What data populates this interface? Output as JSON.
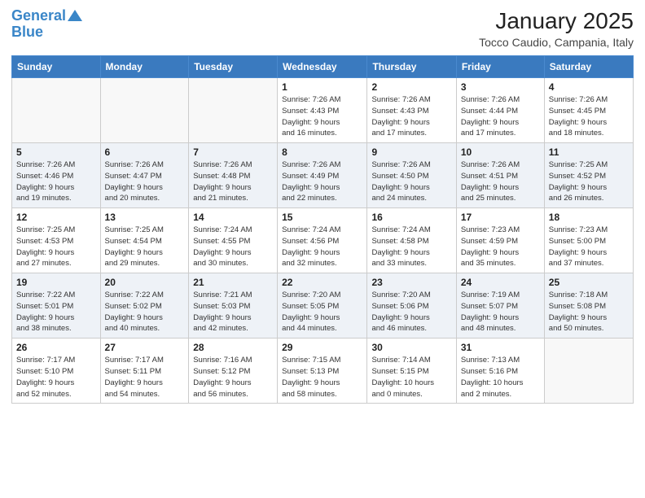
{
  "header": {
    "logo_line1": "General",
    "logo_line2": "Blue",
    "month": "January 2025",
    "location": "Tocco Caudio, Campania, Italy"
  },
  "weekdays": [
    "Sunday",
    "Monday",
    "Tuesday",
    "Wednesday",
    "Thursday",
    "Friday",
    "Saturday"
  ],
  "weeks": [
    [
      {
        "day": "",
        "info": ""
      },
      {
        "day": "",
        "info": ""
      },
      {
        "day": "",
        "info": ""
      },
      {
        "day": "1",
        "info": "Sunrise: 7:26 AM\nSunset: 4:43 PM\nDaylight: 9 hours\nand 16 minutes."
      },
      {
        "day": "2",
        "info": "Sunrise: 7:26 AM\nSunset: 4:43 PM\nDaylight: 9 hours\nand 17 minutes."
      },
      {
        "day": "3",
        "info": "Sunrise: 7:26 AM\nSunset: 4:44 PM\nDaylight: 9 hours\nand 17 minutes."
      },
      {
        "day": "4",
        "info": "Sunrise: 7:26 AM\nSunset: 4:45 PM\nDaylight: 9 hours\nand 18 minutes."
      }
    ],
    [
      {
        "day": "5",
        "info": "Sunrise: 7:26 AM\nSunset: 4:46 PM\nDaylight: 9 hours\nand 19 minutes."
      },
      {
        "day": "6",
        "info": "Sunrise: 7:26 AM\nSunset: 4:47 PM\nDaylight: 9 hours\nand 20 minutes."
      },
      {
        "day": "7",
        "info": "Sunrise: 7:26 AM\nSunset: 4:48 PM\nDaylight: 9 hours\nand 21 minutes."
      },
      {
        "day": "8",
        "info": "Sunrise: 7:26 AM\nSunset: 4:49 PM\nDaylight: 9 hours\nand 22 minutes."
      },
      {
        "day": "9",
        "info": "Sunrise: 7:26 AM\nSunset: 4:50 PM\nDaylight: 9 hours\nand 24 minutes."
      },
      {
        "day": "10",
        "info": "Sunrise: 7:26 AM\nSunset: 4:51 PM\nDaylight: 9 hours\nand 25 minutes."
      },
      {
        "day": "11",
        "info": "Sunrise: 7:25 AM\nSunset: 4:52 PM\nDaylight: 9 hours\nand 26 minutes."
      }
    ],
    [
      {
        "day": "12",
        "info": "Sunrise: 7:25 AM\nSunset: 4:53 PM\nDaylight: 9 hours\nand 27 minutes."
      },
      {
        "day": "13",
        "info": "Sunrise: 7:25 AM\nSunset: 4:54 PM\nDaylight: 9 hours\nand 29 minutes."
      },
      {
        "day": "14",
        "info": "Sunrise: 7:24 AM\nSunset: 4:55 PM\nDaylight: 9 hours\nand 30 minutes."
      },
      {
        "day": "15",
        "info": "Sunrise: 7:24 AM\nSunset: 4:56 PM\nDaylight: 9 hours\nand 32 minutes."
      },
      {
        "day": "16",
        "info": "Sunrise: 7:24 AM\nSunset: 4:58 PM\nDaylight: 9 hours\nand 33 minutes."
      },
      {
        "day": "17",
        "info": "Sunrise: 7:23 AM\nSunset: 4:59 PM\nDaylight: 9 hours\nand 35 minutes."
      },
      {
        "day": "18",
        "info": "Sunrise: 7:23 AM\nSunset: 5:00 PM\nDaylight: 9 hours\nand 37 minutes."
      }
    ],
    [
      {
        "day": "19",
        "info": "Sunrise: 7:22 AM\nSunset: 5:01 PM\nDaylight: 9 hours\nand 38 minutes."
      },
      {
        "day": "20",
        "info": "Sunrise: 7:22 AM\nSunset: 5:02 PM\nDaylight: 9 hours\nand 40 minutes."
      },
      {
        "day": "21",
        "info": "Sunrise: 7:21 AM\nSunset: 5:03 PM\nDaylight: 9 hours\nand 42 minutes."
      },
      {
        "day": "22",
        "info": "Sunrise: 7:20 AM\nSunset: 5:05 PM\nDaylight: 9 hours\nand 44 minutes."
      },
      {
        "day": "23",
        "info": "Sunrise: 7:20 AM\nSunset: 5:06 PM\nDaylight: 9 hours\nand 46 minutes."
      },
      {
        "day": "24",
        "info": "Sunrise: 7:19 AM\nSunset: 5:07 PM\nDaylight: 9 hours\nand 48 minutes."
      },
      {
        "day": "25",
        "info": "Sunrise: 7:18 AM\nSunset: 5:08 PM\nDaylight: 9 hours\nand 50 minutes."
      }
    ],
    [
      {
        "day": "26",
        "info": "Sunrise: 7:17 AM\nSunset: 5:10 PM\nDaylight: 9 hours\nand 52 minutes."
      },
      {
        "day": "27",
        "info": "Sunrise: 7:17 AM\nSunset: 5:11 PM\nDaylight: 9 hours\nand 54 minutes."
      },
      {
        "day": "28",
        "info": "Sunrise: 7:16 AM\nSunset: 5:12 PM\nDaylight: 9 hours\nand 56 minutes."
      },
      {
        "day": "29",
        "info": "Sunrise: 7:15 AM\nSunset: 5:13 PM\nDaylight: 9 hours\nand 58 minutes."
      },
      {
        "day": "30",
        "info": "Sunrise: 7:14 AM\nSunset: 5:15 PM\nDaylight: 10 hours\nand 0 minutes."
      },
      {
        "day": "31",
        "info": "Sunrise: 7:13 AM\nSunset: 5:16 PM\nDaylight: 10 hours\nand 2 minutes."
      },
      {
        "day": "",
        "info": ""
      }
    ]
  ]
}
